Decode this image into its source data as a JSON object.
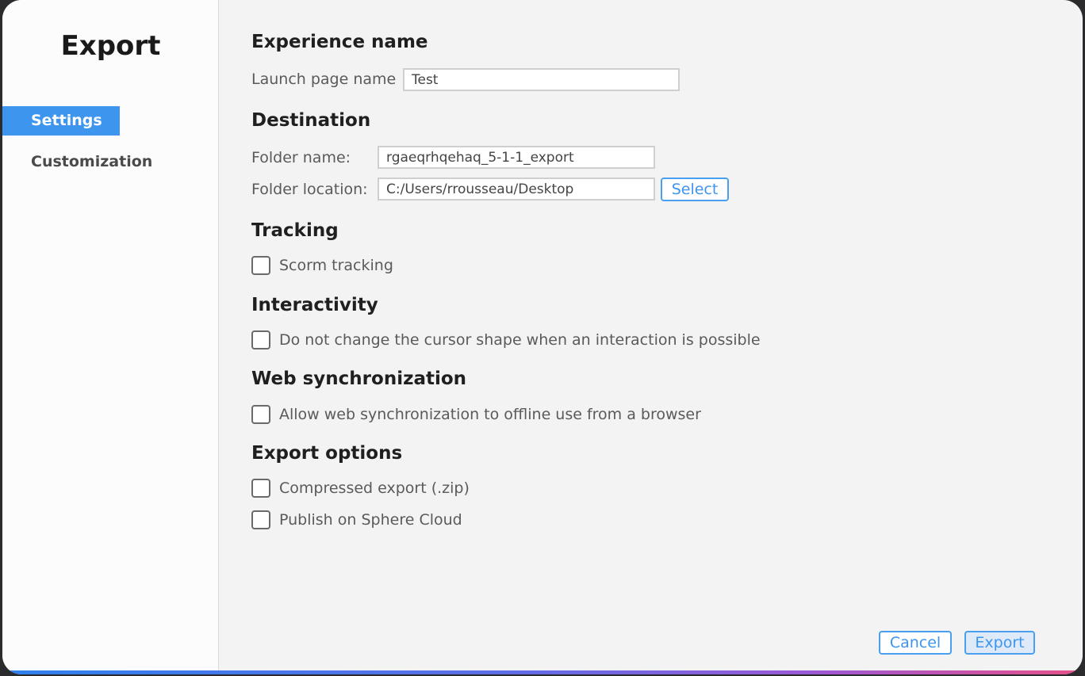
{
  "sidebar": {
    "title": "Export",
    "items": [
      {
        "label": "Settings",
        "active": true
      },
      {
        "label": "Customization",
        "active": false
      }
    ]
  },
  "experience": {
    "title": "Experience name",
    "launch_label": "Launch page name",
    "launch_value": "Test"
  },
  "destination": {
    "title": "Destination",
    "folder_name_label": "Folder name:",
    "folder_name_value": "rgaeqrhqehaq_5-1-1_export",
    "folder_location_label": "Folder location:",
    "folder_location_value": "C:/Users/rrousseau/Desktop",
    "select_label": "Select"
  },
  "tracking": {
    "title": "Tracking",
    "scorm_label": "Scorm tracking",
    "scorm_checked": false
  },
  "interactivity": {
    "title": "Interactivity",
    "cursor_label": "Do not change the cursor shape when an interaction is possible",
    "cursor_checked": false
  },
  "web_sync": {
    "title": "Web synchronization",
    "allow_label": "Allow web synchronization to offline use from a browser",
    "allow_checked": false
  },
  "export_options": {
    "title": "Export options",
    "compressed_label": "Compressed export (.zip)",
    "compressed_checked": false,
    "publish_label": "Publish on Sphere Cloud",
    "publish_checked": false
  },
  "footer": {
    "cancel_label": "Cancel",
    "export_label": "Export"
  },
  "colors": {
    "accent": "#3d95ee",
    "background": "#f3f3f3",
    "sidebar": "#fcfcfc"
  }
}
